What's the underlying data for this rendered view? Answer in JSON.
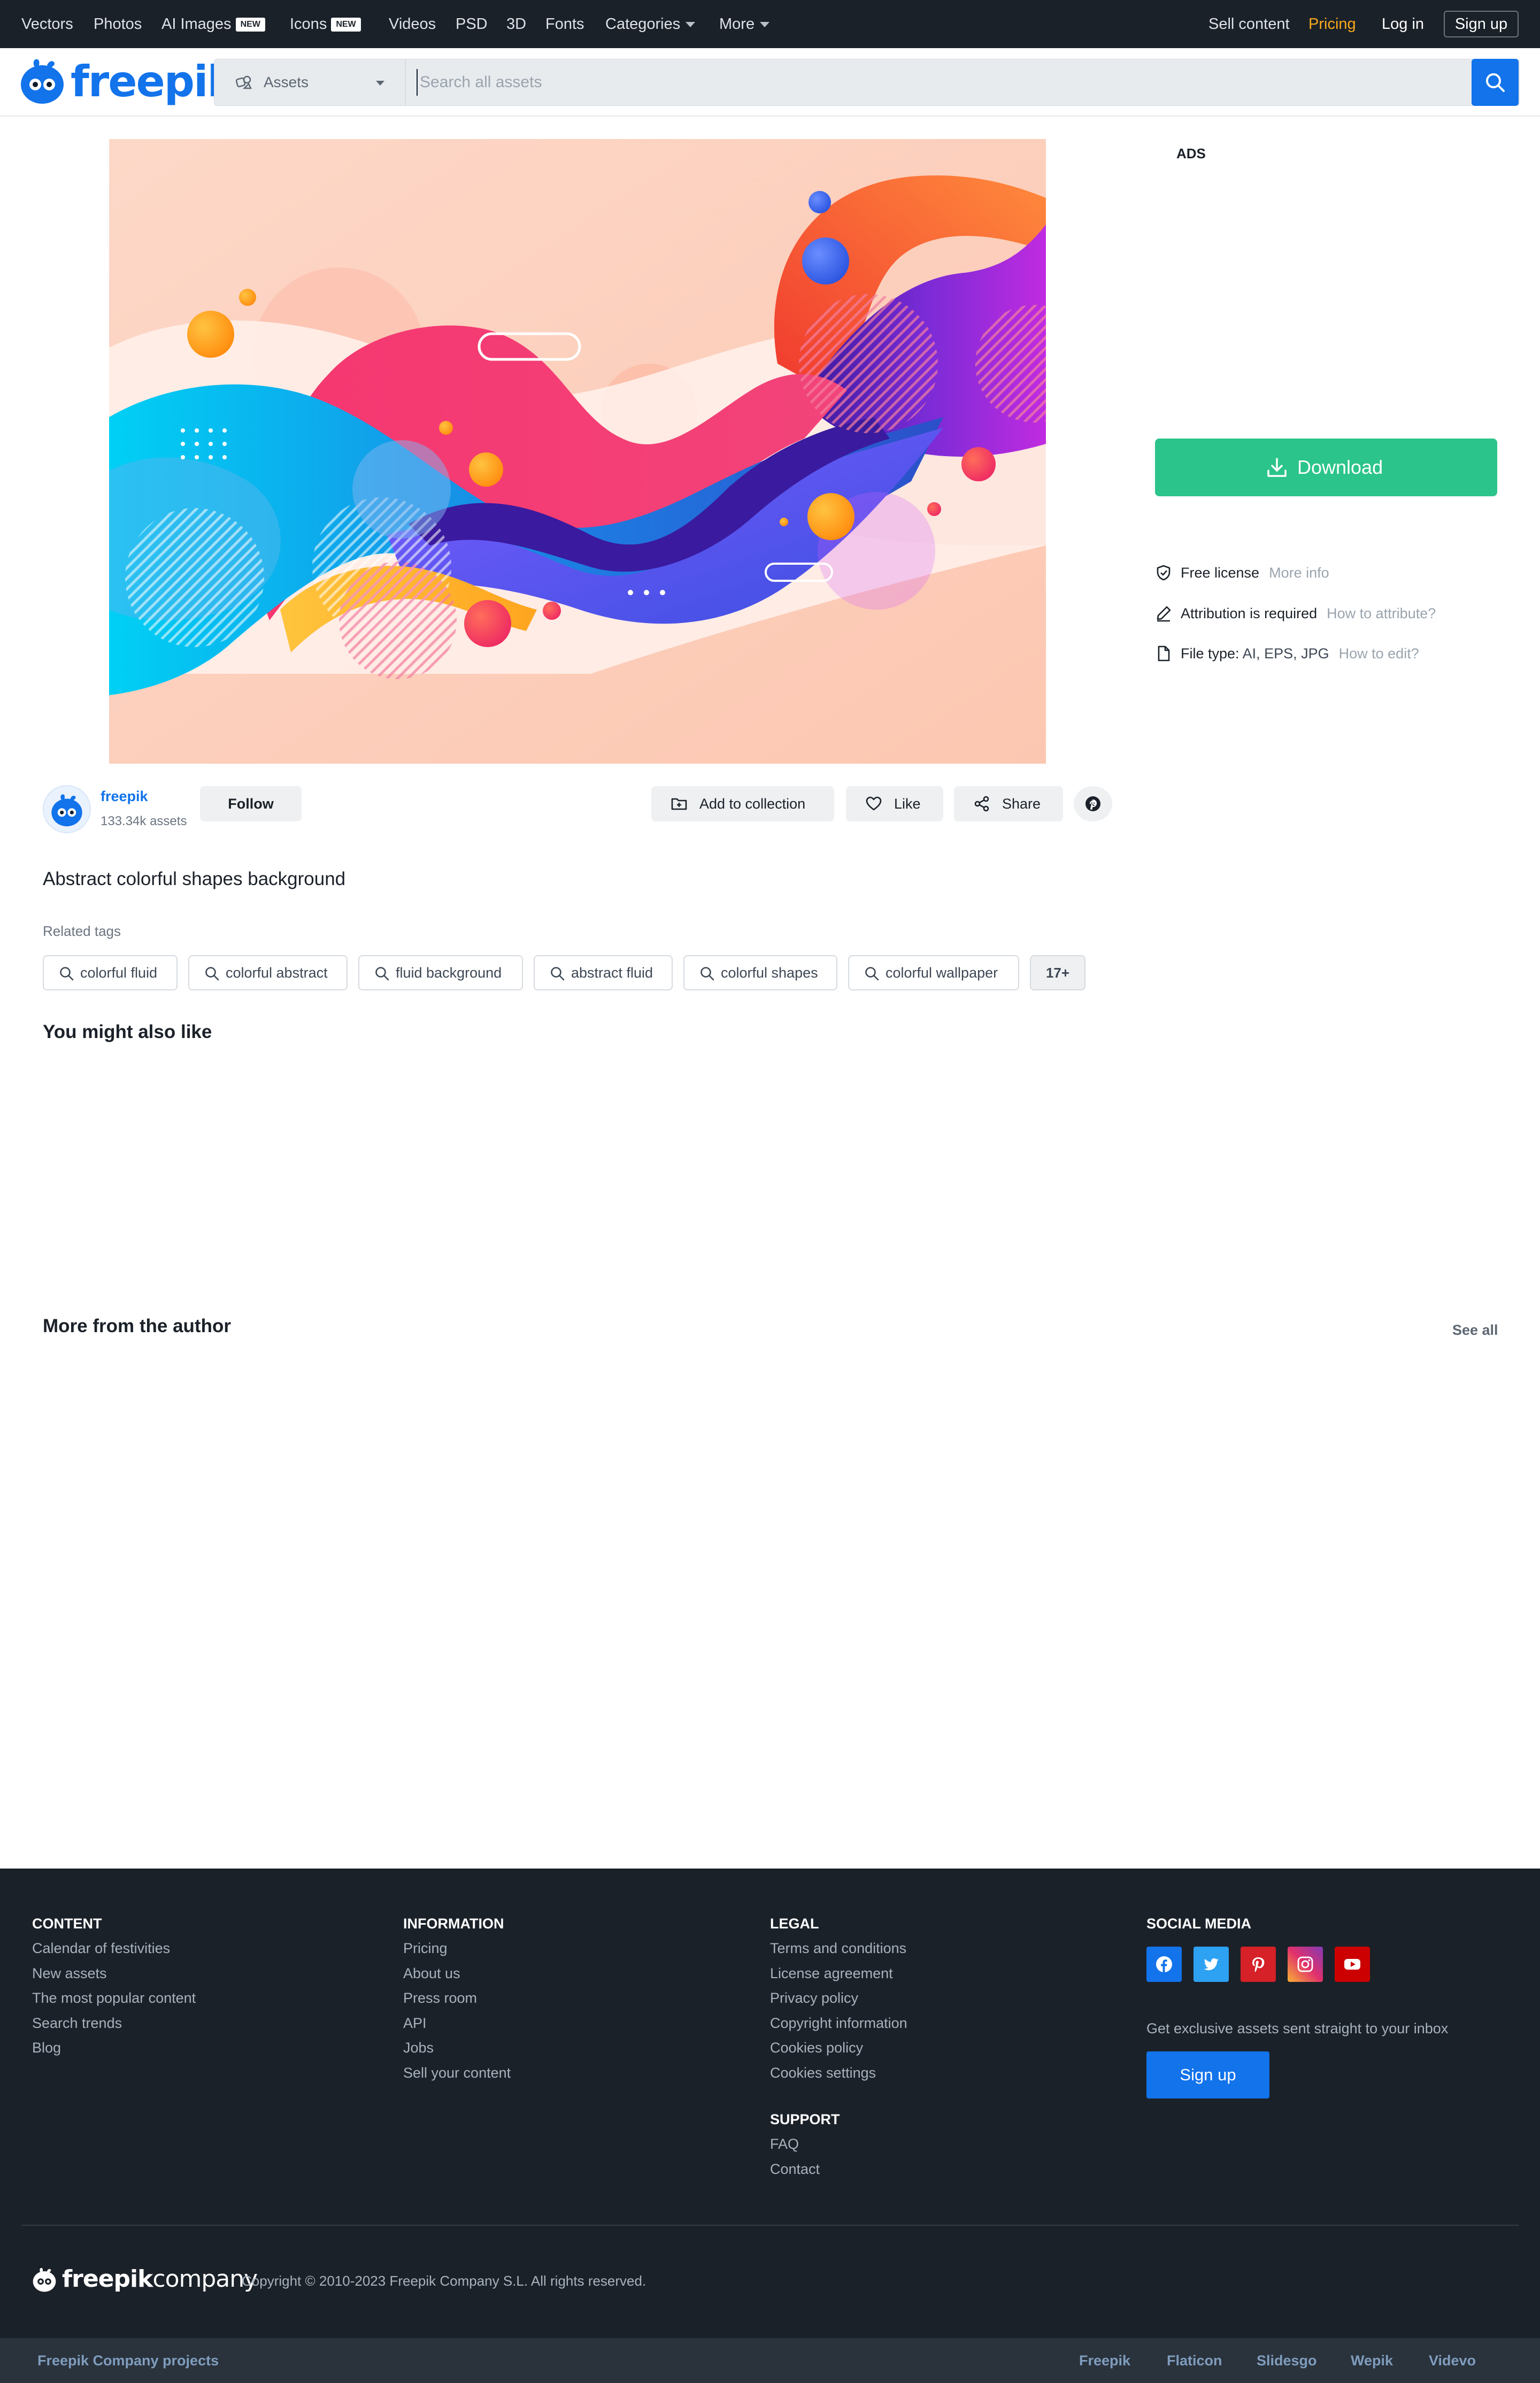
{
  "topnav": {
    "items": [
      "Vectors",
      "Photos",
      "AI Images",
      "Icons",
      "Videos",
      "PSD",
      "3D",
      "Fonts",
      "Categories",
      "More"
    ],
    "new_badge": "NEW",
    "sell": "Sell content",
    "pricing": "Pricing",
    "login": "Log in",
    "signup": "Sign up"
  },
  "header": {
    "logo": "freepik",
    "asset_type": "Assets",
    "search_placeholder": "Search all assets"
  },
  "colors": {
    "brand_blue": "#1273eb",
    "download_green": "#2bc48a",
    "pricing_orange": "#f7a91b",
    "dark_bg": "#1b2129"
  },
  "sidebar": {
    "ads_label": "ADS",
    "download_label": "Download",
    "license": "Free license",
    "license_link": "More info",
    "attribution": "Attribution is required",
    "attribution_link": "How to attribute?",
    "filetype_label": "File type:",
    "filetype_value": "AI, EPS, JPG",
    "filetype_link": "How to edit?"
  },
  "author": {
    "name": "freepik",
    "assets": "133.34k assets",
    "follow": "Follow"
  },
  "actions": {
    "collection": "Add to collection",
    "like": "Like",
    "share": "Share"
  },
  "asset": {
    "title": "Abstract colorful shapes background"
  },
  "related": {
    "heading": "Related tags",
    "tags": [
      "colorful fluid",
      "colorful abstract",
      "fluid background",
      "abstract fluid",
      "colorful shapes",
      "colorful wallpaper"
    ],
    "more": "17+"
  },
  "sections": {
    "also_like": "You might also like",
    "more_author": "More from the author",
    "see_all": "See all"
  },
  "footer": {
    "content": {
      "heading": "CONTENT",
      "links": [
        "Calendar of festivities",
        "New assets",
        "The most popular content",
        "Search trends",
        "Blog"
      ]
    },
    "information": {
      "heading": "INFORMATION",
      "links": [
        "Pricing",
        "About us",
        "Press room",
        "API",
        "Jobs",
        "Sell your content"
      ]
    },
    "legal": {
      "heading": "LEGAL",
      "links": [
        "Terms and conditions",
        "License agreement",
        "Privacy policy",
        "Copyright information",
        "Cookies policy",
        "Cookies settings"
      ]
    },
    "support": {
      "heading": "SUPPORT",
      "links": [
        "FAQ",
        "Contact"
      ]
    },
    "social": {
      "heading": "SOCIAL MEDIA",
      "icons": [
        "facebook-icon",
        "twitter-icon",
        "pinterest-icon",
        "instagram-icon",
        "youtube-icon"
      ],
      "newsletter": "Get exclusive assets sent straight to your inbox",
      "signup": "Sign up"
    },
    "company_logo": "freepik",
    "company_logo_suffix": "company",
    "copyright": "Copyright ©  2010-2023 Freepik Company S.L. All rights reserved."
  },
  "subfooter": {
    "label": "Freepik Company projects",
    "projects": [
      "Freepik",
      "Flaticon",
      "Slidesgo",
      "Wepik",
      "Videvo"
    ]
  }
}
